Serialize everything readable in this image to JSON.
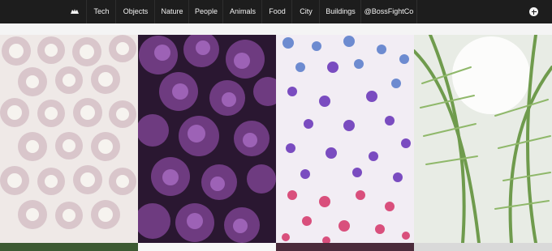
{
  "nav": {
    "logo_icon": "boss-fight-mark-icon",
    "items": [
      "Tech",
      "Objects",
      "Nature",
      "People",
      "Animals",
      "Food",
      "City",
      "Buildings",
      "@BossFightCo"
    ],
    "add_icon": "plus-circle-icon"
  },
  "gallery": {
    "photos": [
      {
        "subject": "roses",
        "colors": [
          "#f1eeea",
          "#dcc7cc",
          "#c5a3b1"
        ]
      },
      {
        "subject": "purple-hydrangea",
        "colors": [
          "#2b1733",
          "#6a3b7b",
          "#9a5fb2"
        ]
      },
      {
        "subject": "scattered-petals",
        "colors": [
          "#f3eef5",
          "#7e5cc3",
          "#d74b7b"
        ]
      },
      {
        "subject": "palm-leaves",
        "colors": [
          "#e9ede6",
          "#6f9a4f",
          "#f7f7f7"
        ]
      }
    ]
  },
  "colors": {
    "topbar": "#1d1d1d",
    "page_background": "#f4f4f4"
  }
}
